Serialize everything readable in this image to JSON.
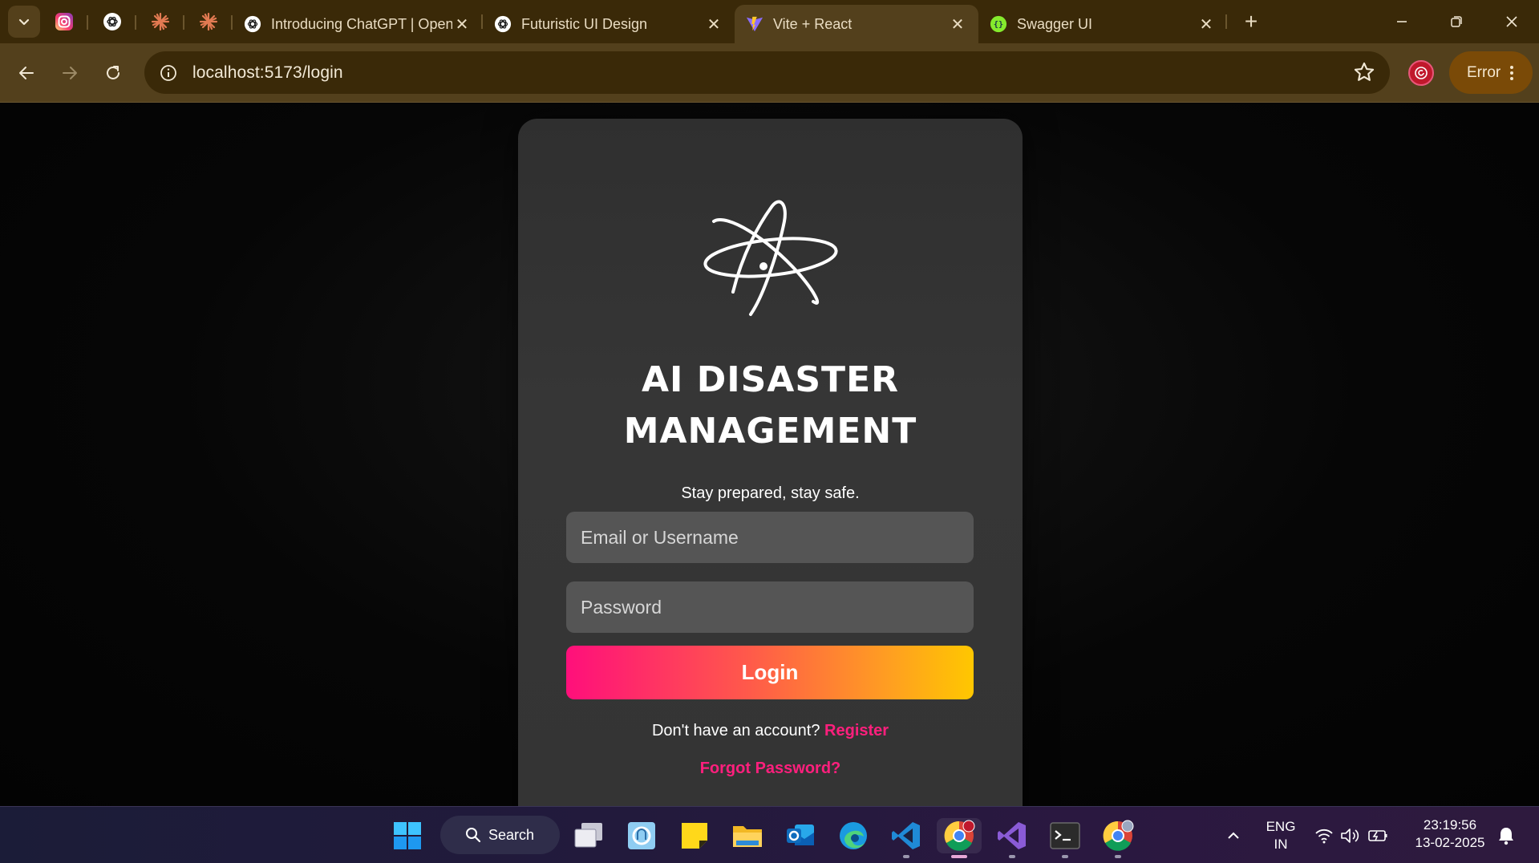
{
  "browser": {
    "tabs": [
      {
        "title": "Introducing ChatGPT | OpenAI",
        "favicon": "openai-icon"
      },
      {
        "title": "Futuristic UI Design",
        "favicon": "openai-icon"
      },
      {
        "title": "Vite + React",
        "favicon": "vite-icon",
        "active": true
      },
      {
        "title": "Swagger UI",
        "favicon": "swagger-icon"
      }
    ],
    "pinned": [
      "instagram-icon",
      "openai-icon",
      "claude-icon",
      "claude-icon"
    ],
    "url": "localhost:5173/login",
    "error_label": "Error",
    "accent": "#53401c"
  },
  "login": {
    "title_line1": "AI DISASTER",
    "title_line2": "MANAGEMENT",
    "tagline": "Stay prepared, stay safe.",
    "email_placeholder": "Email or Username",
    "password_placeholder": "Password",
    "login_label": "Login",
    "register_prompt": "Don't have an account?",
    "register_link": "Register",
    "forgot_link": "Forgot Password?",
    "accent": "#ff1f7d"
  },
  "taskbar": {
    "search_label": "Search",
    "lang_line1": "ENG",
    "lang_line2": "IN",
    "time": "23:19:56",
    "date": "13-02-2025"
  }
}
